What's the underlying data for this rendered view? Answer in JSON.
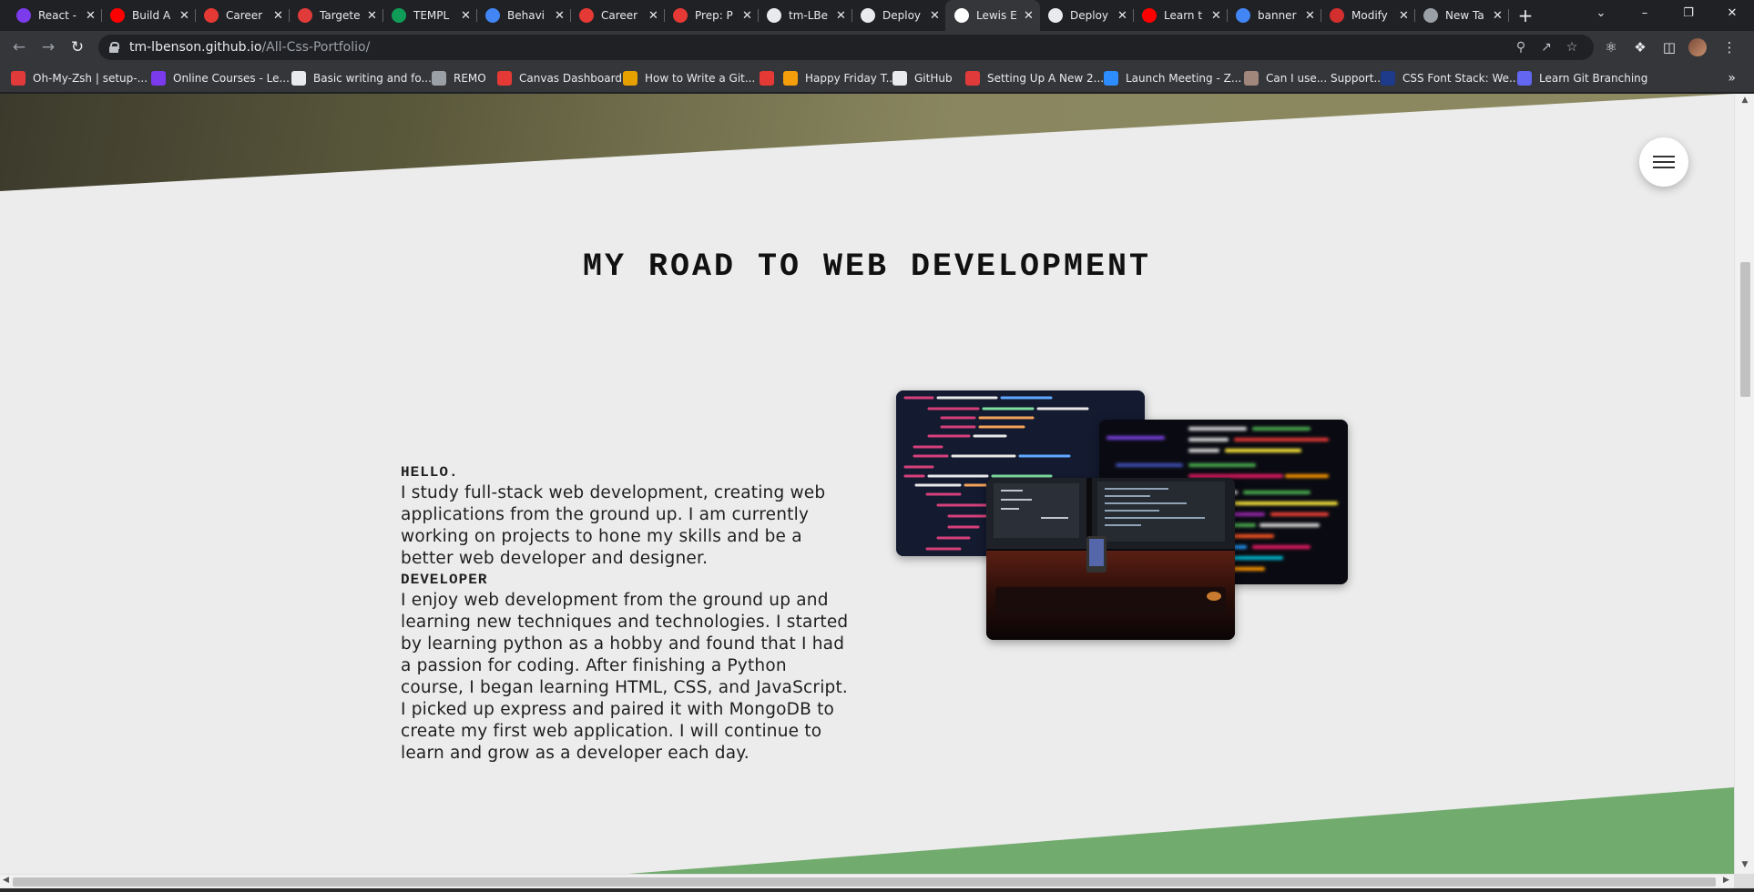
{
  "tabs": [
    {
      "label": "React -",
      "icon": "react-course-icon",
      "color": "#7c3aed",
      "active": false
    },
    {
      "label": "Build A",
      "icon": "youtube-icon",
      "color": "#ff0000",
      "active": false
    },
    {
      "label": "Career",
      "icon": "career-loader-icon",
      "color": "#e53935",
      "active": false
    },
    {
      "label": "Targete",
      "icon": "brave-lion-icon",
      "color": "#e03a3a",
      "active": false
    },
    {
      "label": "TEMPL",
      "icon": "google-sheets-icon",
      "color": "#0f9d58",
      "active": false
    },
    {
      "label": "Behavi",
      "icon": "google-docs-icon",
      "color": "#4285f4",
      "active": false
    },
    {
      "label": "Career",
      "icon": "career-loader-icon",
      "color": "#e53935",
      "active": false
    },
    {
      "label": "Prep: P",
      "icon": "career-loader-icon",
      "color": "#e53935",
      "active": false
    },
    {
      "label": "tm-LBe",
      "icon": "github-icon",
      "color": "#e8eaed",
      "active": false
    },
    {
      "label": "Deploy",
      "icon": "github-icon",
      "color": "#e8eaed",
      "active": false
    },
    {
      "label": "Lewis E",
      "icon": "portfolio-page-icon",
      "color": "#ffffff",
      "active": true
    },
    {
      "label": "Deploy",
      "icon": "github-icon",
      "color": "#e8eaed",
      "active": false
    },
    {
      "label": "Learn t",
      "icon": "youtube-icon",
      "color": "#ff0000",
      "active": false
    },
    {
      "label": "banner",
      "icon": "google-icon",
      "color": "#4285f4",
      "active": false
    },
    {
      "label": "Modify",
      "icon": "adobe-acrobat-icon",
      "color": "#d32f2f",
      "active": false
    },
    {
      "label": "New Ta",
      "icon": "chrome-icon",
      "color": "#9aa0a6",
      "active": false
    }
  ],
  "toolbar": {
    "url_host": "tm-lbenson.github.io",
    "url_path": "/All-Css-Portfolio/"
  },
  "bookmarks": [
    {
      "label": "Oh-My-Zsh | setup-...",
      "icon": "brave-lion-icon",
      "color": "#e03a3a"
    },
    {
      "label": "Online Courses - Le...",
      "icon": "react-course-icon",
      "color": "#7c3aed"
    },
    {
      "label": "Basic writing and fo...",
      "icon": "github-icon",
      "color": "#e8eaed"
    },
    {
      "label": "REMO",
      "icon": "globe-icon",
      "color": "#9aa0a6"
    },
    {
      "label": "Canvas Dashboard",
      "icon": "career-loader-icon",
      "color": "#e53935"
    },
    {
      "label": "How to Write a Git...",
      "icon": "c-letter-icon",
      "color": "#e6a100"
    },
    {
      "label": "",
      "icon": "red-slash-icon",
      "color": "#e53935"
    },
    {
      "label": "Happy Friday T...",
      "icon": "emoji-icon",
      "color": "#f59e0b"
    },
    {
      "label": "GitHub",
      "icon": "github-icon",
      "color": "#e8eaed"
    },
    {
      "label": "Setting Up A New 2...",
      "icon": "brave-lion-icon",
      "color": "#e03a3a"
    },
    {
      "label": "Launch Meeting - Z...",
      "icon": "zoom-icon",
      "color": "#2d8cff"
    },
    {
      "label": "Can I use... Support...",
      "icon": "caniuse-icon",
      "color": "#a1867c"
    },
    {
      "label": "CSS Font Stack: We...",
      "icon": "css-font-stack-icon",
      "color": "#1e3a8a"
    },
    {
      "label": "Learn Git Branching",
      "icon": "git-branching-icon",
      "color": "#6366f1"
    }
  ],
  "page": {
    "heading": "MY ROAD TO WEB DEVELOPMENT",
    "hello_label": "HELLO.",
    "hello_text": "I study full-stack web development, creating web applications from the ground up. I am currently working on projects to hone my skills and be a better web developer and designer.",
    "developer_label": "DEVELOPER",
    "developer_text": "I enjoy web development from the ground up and learning new techniques and technologies. I started by learning python as a hobby and found that I had a passion for coding. After finishing a Python course, I began learning HTML, CSS, and JavaScript. I picked up express and paired it with MongoDB to create my first web application. I will continue to learn and grow as a developer each day."
  },
  "colors": {
    "page_bg": "#ececec",
    "top_banner": "#8c8961",
    "bottom_banner": "#72ab6e"
  }
}
